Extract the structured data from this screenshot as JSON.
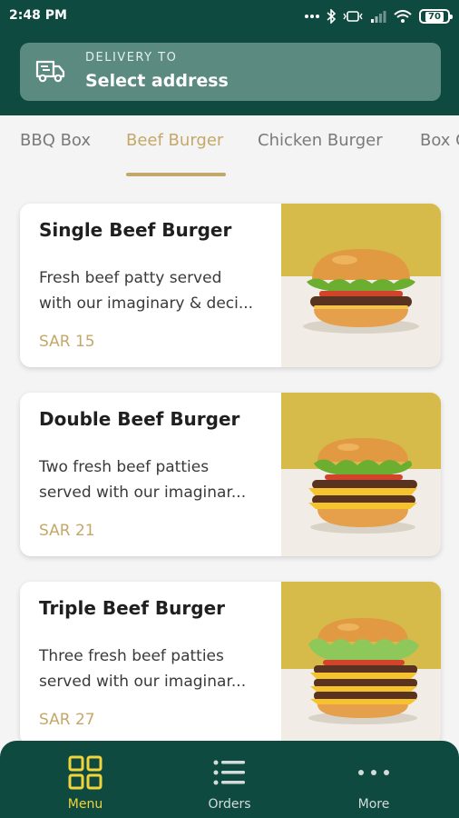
{
  "status_bar": {
    "time": "2:48 PM",
    "battery": "70"
  },
  "delivery": {
    "label": "DELIVERY TO",
    "value": "Select address",
    "icon": "truck-icon"
  },
  "tabs": [
    {
      "label": "BBQ Box",
      "active": false
    },
    {
      "label": "Beef Burger",
      "active": true
    },
    {
      "label": "Chicken Burger",
      "active": false
    },
    {
      "label": "Box C",
      "active": false
    }
  ],
  "products": [
    {
      "name": "Single Beef Burger",
      "desc_line1": "Fresh beef patty served",
      "desc_line2": "with our imaginary & deci...",
      "price": "SAR 15"
    },
    {
      "name": "Double Beef Burger",
      "desc_line1": "Two fresh beef patties",
      "desc_line2": "served with our imaginar...",
      "price": "SAR 21"
    },
    {
      "name": "Triple Beef Burger",
      "desc_line1": "Three fresh beef patties",
      "desc_line2": "served with our imaginar...",
      "price": "SAR 27"
    }
  ],
  "nav": [
    {
      "label": "Menu",
      "icon": "grid-icon",
      "active": true
    },
    {
      "label": "Orders",
      "icon": "list-icon",
      "active": false
    },
    {
      "label": "More",
      "icon": "more-dots-icon",
      "active": false
    }
  ],
  "colors": {
    "primary": "#0f4a41",
    "accent": "#c4a86a",
    "nav_active": "#f0d43a",
    "background": "#f4f4f4"
  }
}
